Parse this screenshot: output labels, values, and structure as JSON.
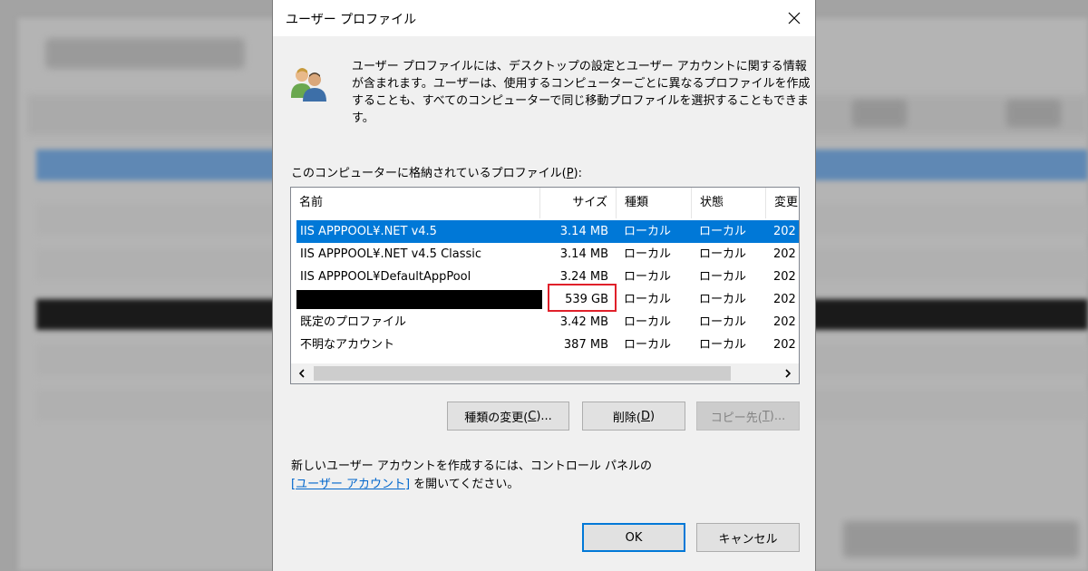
{
  "dialog": {
    "title": "ユーザー プロファイル",
    "description_lines": [
      "ユーザー プロファイルには、デスクトップの設定とユーザー アカウントに関する情報",
      "が含まれます。ユーザーは、使用するコンピューターごとに異なるプロファイルを作成",
      "することも、すべてのコンピューターで同じ移動プロファイルを選択することもできま",
      "す。"
    ],
    "list_label_prefix": "このコンピューターに格納されているプロファイル(",
    "list_label_key": "P",
    "list_label_suffix": "):"
  },
  "listview": {
    "columns": [
      "名前",
      "サイズ",
      "種類",
      "状態",
      "変更"
    ],
    "rows": [
      {
        "name": "IIS APPPOOL¥.NET v4.5",
        "size": "3.14 MB",
        "type": "ローカル",
        "status": "ローカル",
        "modified": "202",
        "selected": true
      },
      {
        "name": "IIS APPPOOL¥.NET v4.5 Classic",
        "size": "3.14 MB",
        "type": "ローカル",
        "status": "ローカル",
        "modified": "202"
      },
      {
        "name": "IIS APPPOOL¥DefaultAppPool",
        "size": "3.24 MB",
        "type": "ローカル",
        "status": "ローカル",
        "modified": "202"
      },
      {
        "name": "",
        "size": "539 GB",
        "type": "ローカル",
        "status": "ローカル",
        "modified": "202",
        "redacted": true,
        "highlighted": true
      },
      {
        "name": "既定のプロファイル",
        "size": "3.42 MB",
        "type": "ローカル",
        "status": "ローカル",
        "modified": "202"
      },
      {
        "name": "不明なアカウント",
        "size": "387 MB",
        "type": "ローカル",
        "status": "ローカル",
        "modified": "202"
      }
    ]
  },
  "buttons": {
    "change_type": {
      "text": "種類の変更(",
      "key": "C",
      "suffix": ")..."
    },
    "delete": {
      "text": "削除(",
      "key": "D",
      "suffix": ")"
    },
    "copy_to": {
      "text": "コピー先(",
      "key": "T",
      "suffix": ")..."
    },
    "ok": "OK",
    "cancel": "キャンセル"
  },
  "footer": {
    "line1": "新しいユーザー アカウントを作成するには、コントロール パネルの",
    "bracket_open": "[",
    "link": "ユーザー アカウント",
    "bracket_close": "]",
    "line2_suffix": " を開いてください。"
  },
  "colors": {
    "selection": "#0078d7",
    "highlight_border": "#e0202a",
    "link": "#0066cc",
    "dialog_bg": "#f0f0f0"
  },
  "icons": [
    "users-icon",
    "close-icon",
    "chevron-left-icon",
    "chevron-right-icon"
  ]
}
